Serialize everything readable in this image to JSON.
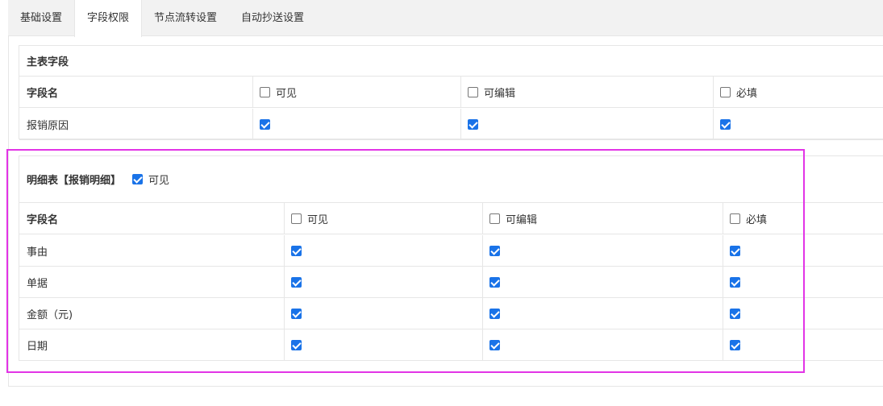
{
  "tabs": [
    {
      "label": "基础设置",
      "active": false
    },
    {
      "label": "字段权限",
      "active": true
    },
    {
      "label": "节点流转设置",
      "active": false
    },
    {
      "label": "自动抄送设置",
      "active": false
    }
  ],
  "main_table": {
    "title": "主表字段",
    "headers": {
      "field": "字段名",
      "visible": "可见",
      "editable": "可编辑",
      "required": "必填"
    },
    "header_checked": {
      "visible": false,
      "editable": false,
      "required": false
    },
    "rows": [
      {
        "name": "报销原因",
        "visible": true,
        "editable": true,
        "required": true
      }
    ]
  },
  "detail_table": {
    "title": "明细表【报销明细】",
    "title_visible_label": "可见",
    "title_visible_checked": true,
    "headers": {
      "field": "字段名",
      "visible": "可见",
      "editable": "可编辑",
      "required": "必填"
    },
    "header_checked": {
      "visible": false,
      "editable": false,
      "required": false
    },
    "rows": [
      {
        "name": "事由",
        "visible": true,
        "editable": true,
        "required": true
      },
      {
        "name": "单据",
        "visible": true,
        "editable": true,
        "required": true
      },
      {
        "name": "金额（元)",
        "visible": true,
        "editable": true,
        "required": true
      },
      {
        "name": "日期",
        "visible": true,
        "editable": true,
        "required": true
      }
    ]
  },
  "colors": {
    "accent": "#1a73e8",
    "highlight": "#e234e6",
    "border": "#e6e6e6",
    "tabbar": "#f2f2f2"
  }
}
